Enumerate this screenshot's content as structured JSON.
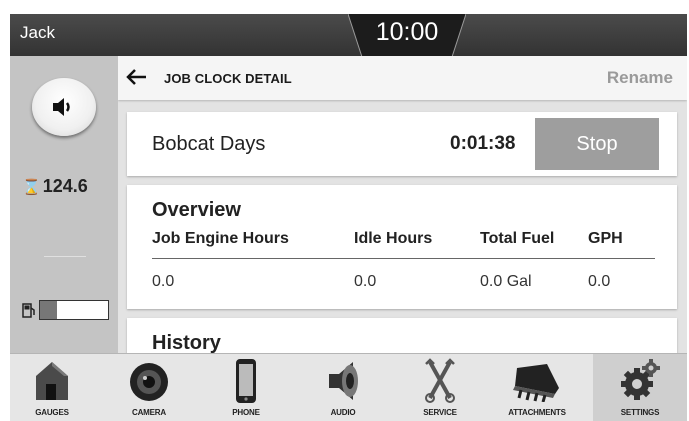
{
  "status_bar": {
    "user": "Jack",
    "time": "10:00"
  },
  "side_panel": {
    "volume_icon": "speaker-icon",
    "engine_hours": "124.6",
    "hours_icon": "hourglass-icon",
    "fuel_icon": "fuel-pump-icon",
    "fuel_level_fraction": 0.25
  },
  "header": {
    "title": "JOB CLOCK DETAIL",
    "back_icon": "back-arrow-icon",
    "rename_label": "Rename"
  },
  "job": {
    "name": "Bobcat Days",
    "elapsed": "0:01:38",
    "stop_label": "Stop"
  },
  "overview": {
    "title": "Overview",
    "columns": [
      "Job Engine Hours",
      "Idle Hours",
      "Total Fuel",
      "GPH"
    ],
    "values": [
      "0.0",
      "0.0",
      "0.0 Gal",
      "0.0"
    ]
  },
  "history": {
    "title": "History"
  },
  "nav": {
    "items": [
      {
        "label": "GAUGES",
        "icon": "house-icon"
      },
      {
        "label": "CAMERA",
        "icon": "camera-icon"
      },
      {
        "label": "PHONE",
        "icon": "phone-icon"
      },
      {
        "label": "AUDIO",
        "icon": "speaker-icon"
      },
      {
        "label": "SERVICE",
        "icon": "wrench-icon"
      },
      {
        "label": "ATTACHMENTS",
        "icon": "bucket-icon"
      },
      {
        "label": "SETTINGS",
        "icon": "gear-icon"
      }
    ],
    "selected": "SETTINGS"
  },
  "colors": {
    "stop_button": "#9e9e9e",
    "top_bar": "#3c3c3c",
    "left_panel": "#c4c4c4",
    "background": "#e3e3e3"
  }
}
